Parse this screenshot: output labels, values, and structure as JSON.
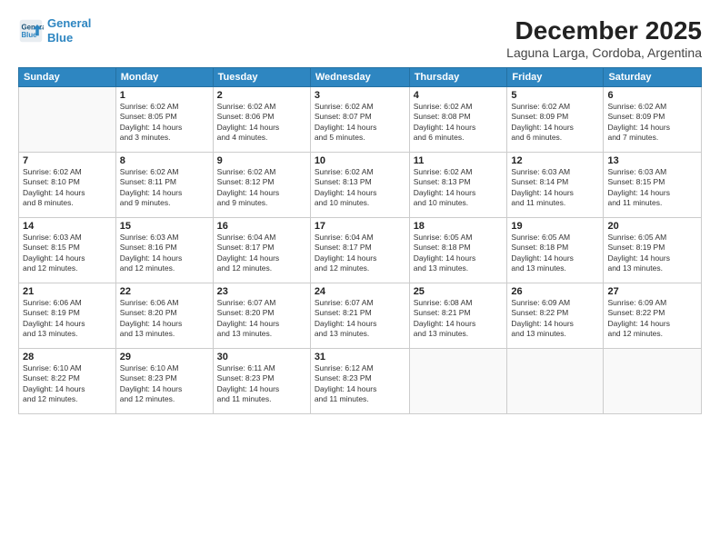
{
  "logo": {
    "line1": "General",
    "line2": "Blue"
  },
  "title": "December 2025",
  "subtitle": "Laguna Larga, Cordoba, Argentina",
  "days_of_week": [
    "Sunday",
    "Monday",
    "Tuesday",
    "Wednesday",
    "Thursday",
    "Friday",
    "Saturday"
  ],
  "weeks": [
    [
      {
        "day": "",
        "info": ""
      },
      {
        "day": "1",
        "info": "Sunrise: 6:02 AM\nSunset: 8:05 PM\nDaylight: 14 hours\nand 3 minutes."
      },
      {
        "day": "2",
        "info": "Sunrise: 6:02 AM\nSunset: 8:06 PM\nDaylight: 14 hours\nand 4 minutes."
      },
      {
        "day": "3",
        "info": "Sunrise: 6:02 AM\nSunset: 8:07 PM\nDaylight: 14 hours\nand 5 minutes."
      },
      {
        "day": "4",
        "info": "Sunrise: 6:02 AM\nSunset: 8:08 PM\nDaylight: 14 hours\nand 6 minutes."
      },
      {
        "day": "5",
        "info": "Sunrise: 6:02 AM\nSunset: 8:09 PM\nDaylight: 14 hours\nand 6 minutes."
      },
      {
        "day": "6",
        "info": "Sunrise: 6:02 AM\nSunset: 8:09 PM\nDaylight: 14 hours\nand 7 minutes."
      }
    ],
    [
      {
        "day": "7",
        "info": "Sunrise: 6:02 AM\nSunset: 8:10 PM\nDaylight: 14 hours\nand 8 minutes."
      },
      {
        "day": "8",
        "info": "Sunrise: 6:02 AM\nSunset: 8:11 PM\nDaylight: 14 hours\nand 9 minutes."
      },
      {
        "day": "9",
        "info": "Sunrise: 6:02 AM\nSunset: 8:12 PM\nDaylight: 14 hours\nand 9 minutes."
      },
      {
        "day": "10",
        "info": "Sunrise: 6:02 AM\nSunset: 8:13 PM\nDaylight: 14 hours\nand 10 minutes."
      },
      {
        "day": "11",
        "info": "Sunrise: 6:02 AM\nSunset: 8:13 PM\nDaylight: 14 hours\nand 10 minutes."
      },
      {
        "day": "12",
        "info": "Sunrise: 6:03 AM\nSunset: 8:14 PM\nDaylight: 14 hours\nand 11 minutes."
      },
      {
        "day": "13",
        "info": "Sunrise: 6:03 AM\nSunset: 8:15 PM\nDaylight: 14 hours\nand 11 minutes."
      }
    ],
    [
      {
        "day": "14",
        "info": "Sunrise: 6:03 AM\nSunset: 8:15 PM\nDaylight: 14 hours\nand 12 minutes."
      },
      {
        "day": "15",
        "info": "Sunrise: 6:03 AM\nSunset: 8:16 PM\nDaylight: 14 hours\nand 12 minutes."
      },
      {
        "day": "16",
        "info": "Sunrise: 6:04 AM\nSunset: 8:17 PM\nDaylight: 14 hours\nand 12 minutes."
      },
      {
        "day": "17",
        "info": "Sunrise: 6:04 AM\nSunset: 8:17 PM\nDaylight: 14 hours\nand 12 minutes."
      },
      {
        "day": "18",
        "info": "Sunrise: 6:05 AM\nSunset: 8:18 PM\nDaylight: 14 hours\nand 13 minutes."
      },
      {
        "day": "19",
        "info": "Sunrise: 6:05 AM\nSunset: 8:18 PM\nDaylight: 14 hours\nand 13 minutes."
      },
      {
        "day": "20",
        "info": "Sunrise: 6:05 AM\nSunset: 8:19 PM\nDaylight: 14 hours\nand 13 minutes."
      }
    ],
    [
      {
        "day": "21",
        "info": "Sunrise: 6:06 AM\nSunset: 8:19 PM\nDaylight: 14 hours\nand 13 minutes."
      },
      {
        "day": "22",
        "info": "Sunrise: 6:06 AM\nSunset: 8:20 PM\nDaylight: 14 hours\nand 13 minutes."
      },
      {
        "day": "23",
        "info": "Sunrise: 6:07 AM\nSunset: 8:20 PM\nDaylight: 14 hours\nand 13 minutes."
      },
      {
        "day": "24",
        "info": "Sunrise: 6:07 AM\nSunset: 8:21 PM\nDaylight: 14 hours\nand 13 minutes."
      },
      {
        "day": "25",
        "info": "Sunrise: 6:08 AM\nSunset: 8:21 PM\nDaylight: 14 hours\nand 13 minutes."
      },
      {
        "day": "26",
        "info": "Sunrise: 6:09 AM\nSunset: 8:22 PM\nDaylight: 14 hours\nand 13 minutes."
      },
      {
        "day": "27",
        "info": "Sunrise: 6:09 AM\nSunset: 8:22 PM\nDaylight: 14 hours\nand 12 minutes."
      }
    ],
    [
      {
        "day": "28",
        "info": "Sunrise: 6:10 AM\nSunset: 8:22 PM\nDaylight: 14 hours\nand 12 minutes."
      },
      {
        "day": "29",
        "info": "Sunrise: 6:10 AM\nSunset: 8:23 PM\nDaylight: 14 hours\nand 12 minutes."
      },
      {
        "day": "30",
        "info": "Sunrise: 6:11 AM\nSunset: 8:23 PM\nDaylight: 14 hours\nand 11 minutes."
      },
      {
        "day": "31",
        "info": "Sunrise: 6:12 AM\nSunset: 8:23 PM\nDaylight: 14 hours\nand 11 minutes."
      },
      {
        "day": "",
        "info": ""
      },
      {
        "day": "",
        "info": ""
      },
      {
        "day": "",
        "info": ""
      }
    ]
  ]
}
